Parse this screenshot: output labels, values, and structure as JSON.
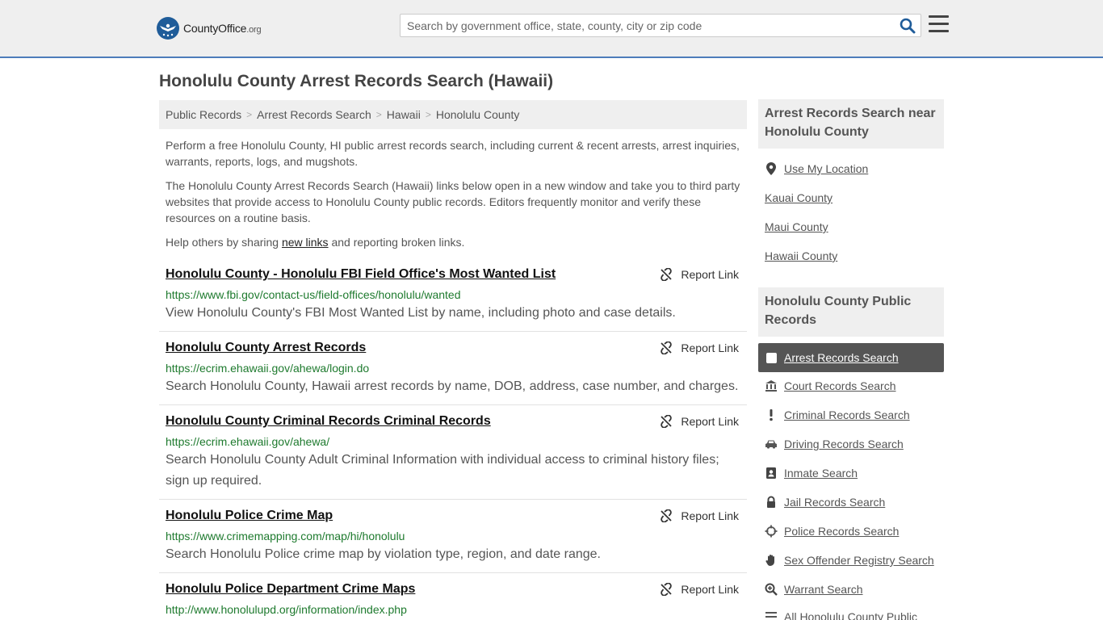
{
  "header": {
    "logo_main": "CountyOffice",
    "logo_tld": ".org",
    "search_placeholder": "Search by government office, state, county, city or zip code"
  },
  "page_title": "Honolulu County Arrest Records Search (Hawaii)",
  "breadcrumb": [
    "Public Records",
    "Arrest Records Search",
    "Hawaii",
    "Honolulu County"
  ],
  "intro": {
    "p1": "Perform a free Honolulu County, HI public arrest records search, including current & recent arrests, arrest inquiries, warrants, reports, logs, and mugshots.",
    "p2": "The Honolulu County Arrest Records Search (Hawaii) links below open in a new window and take you to third party websites that provide access to Honolulu County public records. Editors frequently monitor and verify these resources on a routine basis.",
    "p3_before": "Help others by sharing ",
    "p3_link": "new links",
    "p3_after": " and reporting broken links."
  },
  "report_label": "Report Link",
  "results": [
    {
      "title": "Honolulu County - Honolulu FBI Field Office's Most Wanted List",
      "url": "https://www.fbi.gov/contact-us/field-offices/honolulu/wanted",
      "desc": "View Honolulu County's FBI Most Wanted List by name, including photo and case details."
    },
    {
      "title": "Honolulu County Arrest Records",
      "url": "https://ecrim.ehawaii.gov/ahewa/login.do",
      "desc": "Search Honolulu County, Hawaii arrest records by name, DOB, address, case number, and charges."
    },
    {
      "title": "Honolulu County Criminal Records Criminal Records",
      "url": "https://ecrim.ehawaii.gov/ahewa/",
      "desc": "Search Honolulu County Adult Criminal Information with individual access to criminal history files; sign up required."
    },
    {
      "title": "Honolulu Police Crime Map",
      "url": "https://www.crimemapping.com/map/hi/honolulu",
      "desc": "Search Honolulu Police crime map by violation type, region, and date range."
    },
    {
      "title": "Honolulu Police Department Crime Maps",
      "url": "http://www.honolulupd.org/information/index.php",
      "desc": ""
    }
  ],
  "sidebar": {
    "nearby_heading": "Arrest Records Search near Honolulu County",
    "nearby": [
      "Use My Location",
      "Kauai County",
      "Maui County",
      "Hawaii County"
    ],
    "public_heading": "Honolulu County Public Records",
    "public_links": [
      {
        "label": "Arrest Records Search",
        "icon": "square-icon",
        "active": true
      },
      {
        "label": "Court Records Search",
        "icon": "courthouse-icon"
      },
      {
        "label": "Criminal Records Search",
        "icon": "exclamation-icon"
      },
      {
        "label": "Driving Records Search",
        "icon": "car-icon"
      },
      {
        "label": "Inmate Search",
        "icon": "id-card-icon"
      },
      {
        "label": "Jail Records Search",
        "icon": "lock-icon"
      },
      {
        "label": "Police Records Search",
        "icon": "crosshair-icon"
      },
      {
        "label": "Sex Offender Registry Search",
        "icon": "hand-icon"
      },
      {
        "label": "Warrant Search",
        "icon": "magnifier-plus-icon"
      },
      {
        "label": "All Honolulu County Public",
        "icon": "list-icon"
      }
    ]
  },
  "colors": {
    "accent_blue": "#4d7cba",
    "url_green": "#1e7a2e",
    "active_bg": "#555555"
  }
}
